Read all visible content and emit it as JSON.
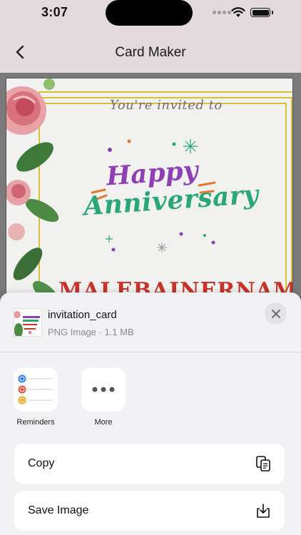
{
  "status_bar": {
    "time": "3:07",
    "battery_level": 1.0
  },
  "nav": {
    "title": "Card Maker",
    "back_icon": "chevron-left-icon"
  },
  "card": {
    "invited_text": "You're invited to",
    "headline_1": "Happy",
    "headline_2": "Anniversary",
    "name_text": "MALEBAINERNAME"
  },
  "share_sheet": {
    "file_name": "invitation_card",
    "file_meta": "PNG Image · 1.1 MB",
    "close_icon": "close-icon",
    "apps": [
      {
        "label": "Reminders",
        "icon": "reminders-icon"
      },
      {
        "label": "More",
        "icon": "more-icon"
      }
    ],
    "actions": [
      {
        "label": "Copy",
        "icon": "copy-icon"
      },
      {
        "label": "Save Image",
        "icon": "save-image-icon"
      }
    ]
  },
  "colors": {
    "header_bg": "#e2dadd",
    "sheet_bg": "#f2f2f4",
    "happy": "#8e3fb4",
    "anniversary": "#2aa779",
    "name": "#c8332b",
    "gold_frame": "#d9c03a"
  }
}
